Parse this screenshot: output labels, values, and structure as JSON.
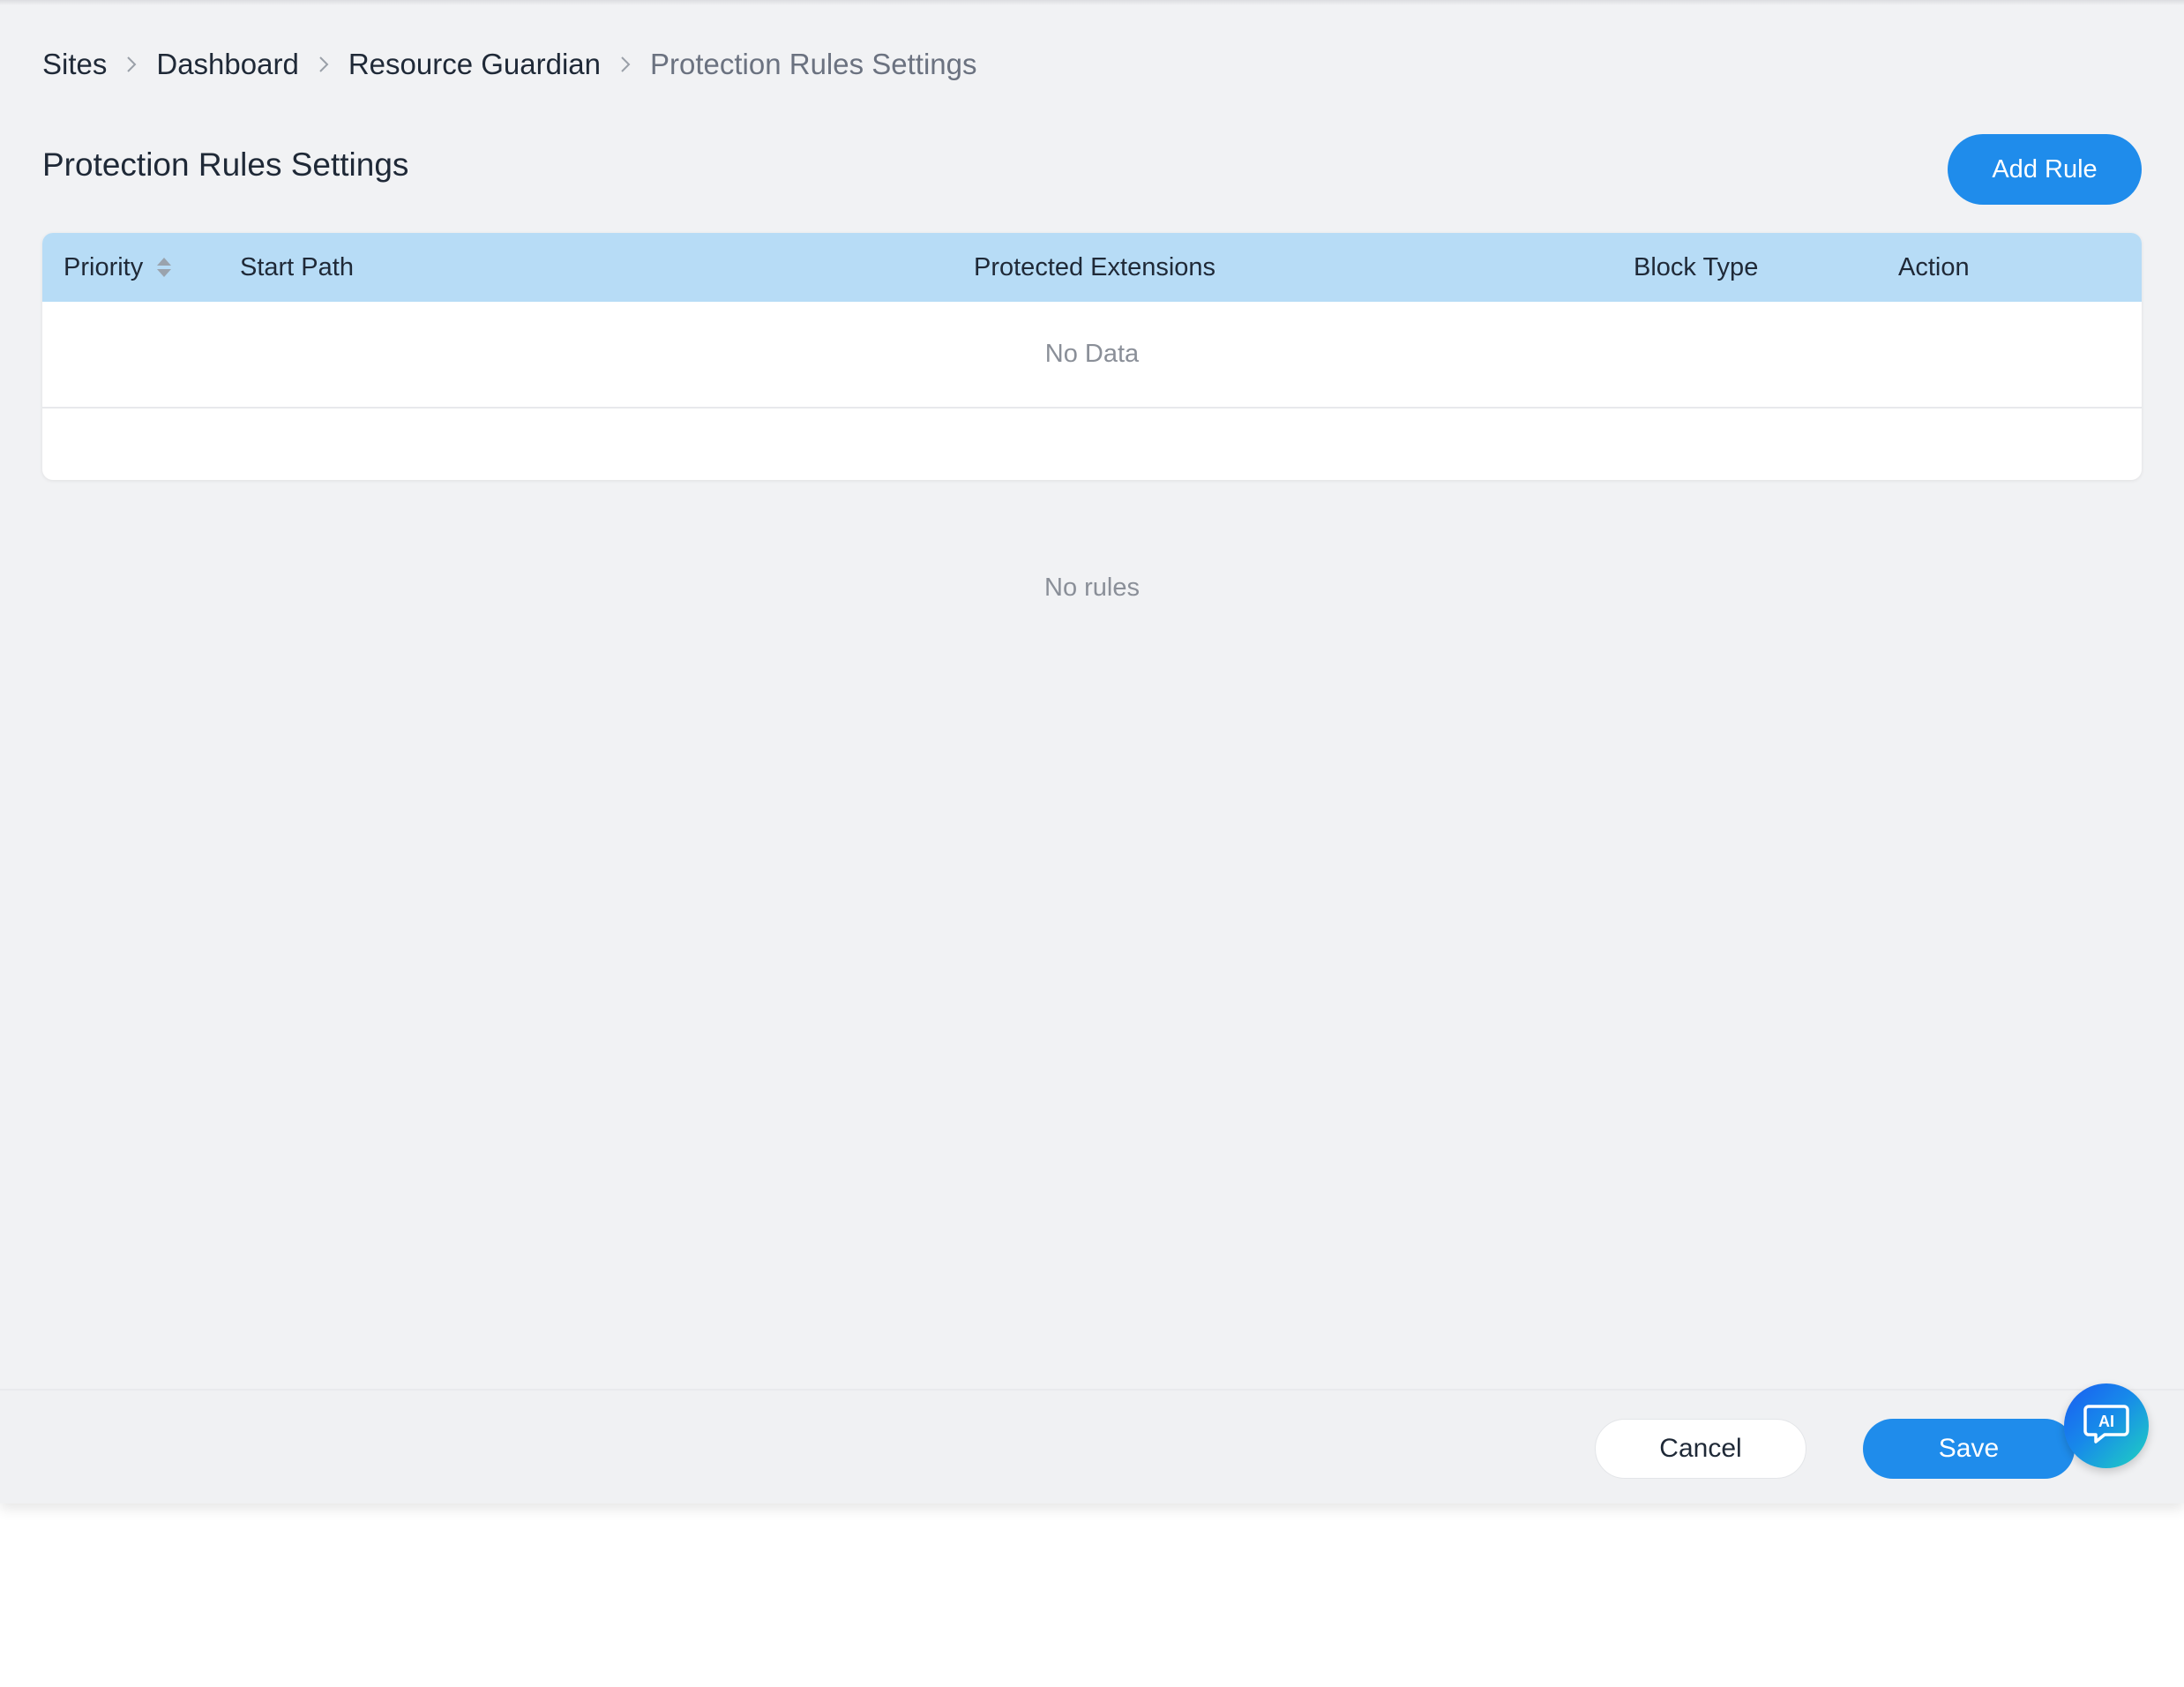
{
  "breadcrumb": {
    "items": [
      "Sites",
      "Dashboard",
      "Resource Guardian",
      "Protection Rules Settings"
    ]
  },
  "header": {
    "title": "Protection Rules Settings",
    "add_rule_label": "Add Rule"
  },
  "table": {
    "columns": [
      "Priority",
      "Start Path",
      "Protected Extensions",
      "Block Type",
      "Action"
    ],
    "empty_text": "No Data"
  },
  "empty_state": "No rules",
  "footer": {
    "cancel_label": "Cancel",
    "save_label": "Save"
  },
  "ai_button": {
    "label": "AI",
    "icon": "ai-chat-icon"
  },
  "colors": {
    "primary": "#1f8ceb",
    "table_header": "#b7dcf6",
    "page_background": "#f1f2f4"
  }
}
